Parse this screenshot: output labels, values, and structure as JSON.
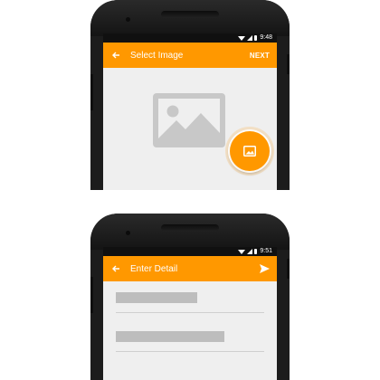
{
  "top_screen": {
    "status_bar": {
      "time": "9:48"
    },
    "toolbar": {
      "title": "Select Image",
      "action_label": "NEXT"
    }
  },
  "bottom_screen": {
    "status_bar": {
      "time": "9:51"
    },
    "toolbar": {
      "title": "Enter Detail"
    },
    "fields": [
      {
        "placeholder_fill": 0.55
      },
      {
        "placeholder_fill": 0.73
      }
    ]
  },
  "colors": {
    "accent": "#ff9800",
    "status_bar": "#101010",
    "screen_background": "#efefef",
    "placeholder_gray": "#c8c8c8"
  },
  "icons": {
    "back": "arrow-left-icon",
    "image_placeholder": "image-icon",
    "fab": "image-icon",
    "send": "send-icon"
  }
}
